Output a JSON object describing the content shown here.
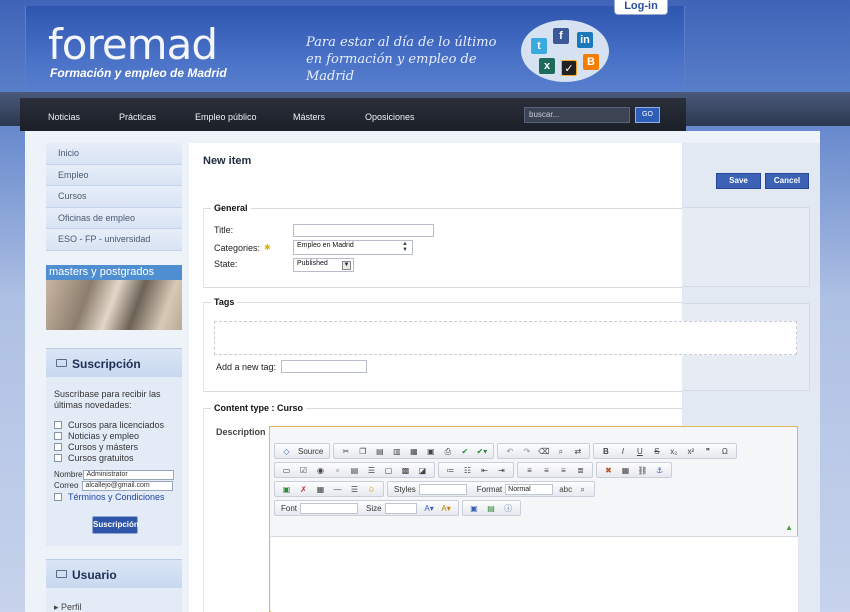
{
  "header": {
    "logo": "foremad",
    "logo_sub": "Formación y empleo de Madrid",
    "slogan_line1": "Para estar al día de lo último",
    "slogan_line2": "en formación y empleo de Madrid",
    "login_label": "Log-in",
    "social": [
      "twitter-icon",
      "facebook-icon",
      "linkedin-icon",
      "xing-icon",
      "tuenti-icon",
      "blogger-icon"
    ]
  },
  "nav": {
    "items": [
      "Noticias",
      "Prácticas",
      "Empleo público",
      "Másters",
      "Oposiciones"
    ],
    "search_placeholder": "buscar...",
    "go_label": "GO"
  },
  "sidebar": {
    "items": [
      "Inicio",
      "Empleo",
      "Cursos",
      "Oficinas de empleo",
      "ESO - FP - universidad"
    ],
    "banner_title": "masters y postgrados"
  },
  "subscription": {
    "title": "Suscripción",
    "intro": "Suscríbase para recibir las últimas novedades:",
    "options": [
      "Cursos para licenciados",
      "Noticias y empleo",
      "Cursos y másters",
      "Cursos gratuitos"
    ],
    "name_label": "Nombre",
    "name_value": "Administrator",
    "email_label": "Correo",
    "email_value": "alcallejo@gmail.com",
    "terms": "Términos y Condiciones",
    "button": "Suscripción"
  },
  "user_box": {
    "title": "Usuario",
    "first_item": "Perfil"
  },
  "form": {
    "title": "New item",
    "save": "Save",
    "cancel": "Cancel",
    "general_legend": "General",
    "title_label": "Title:",
    "title_value": "",
    "categories_label": "Categories:",
    "categories_value": "Empleo en Madrid",
    "state_label": "State:",
    "state_value": "Published",
    "tags_legend": "Tags",
    "add_tag_label": "Add a new tag:",
    "content_type_legend": "Content type : Curso",
    "description_label": "Description"
  },
  "editor": {
    "source_label": "Source",
    "styles_label": "Styles",
    "format_label": "Format",
    "format_value": "Normal",
    "font_label": "Font",
    "size_label": "Size"
  },
  "colors": {
    "accent": "#3b62b5",
    "header_blue": "#3f64b8",
    "nav_dark": "#1b1f27",
    "editor_border": "#e0b858"
  }
}
